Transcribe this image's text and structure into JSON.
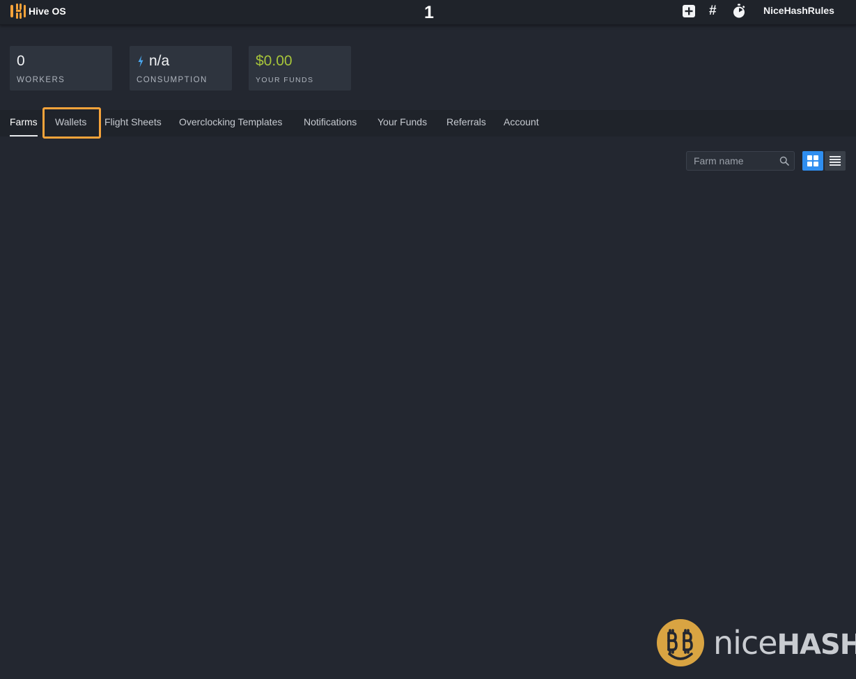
{
  "app": {
    "brand_name": "Hive OS",
    "step_number": "1",
    "username": "NiceHashRules"
  },
  "header_icons": [
    "plus-square-icon",
    "hash-icon",
    "stopwatch-icon"
  ],
  "stats": {
    "workers": {
      "value": "0",
      "label": "WORKERS"
    },
    "consumption": {
      "value": "n/a",
      "label": "CONSUMPTION"
    },
    "funds": {
      "value": "$0.00",
      "label": "YOUR FUNDS",
      "value_color": "#a6c43a"
    }
  },
  "tabs": [
    {
      "label": "Farms",
      "active": true
    },
    {
      "label": "Wallets",
      "active": false,
      "highlighted": true
    },
    {
      "label": "Flight Sheets",
      "active": false
    },
    {
      "label": "Overclocking Templates",
      "active": false
    },
    {
      "label": "Notifications",
      "active": false
    },
    {
      "label": "Your Funds",
      "active": false
    },
    {
      "label": "Referrals",
      "active": false
    },
    {
      "label": "Account",
      "active": false
    }
  ],
  "search": {
    "placeholder": "Farm name",
    "value": ""
  },
  "view_toggle": {
    "selected": "grid",
    "options": [
      "grid",
      "list"
    ]
  },
  "colors": {
    "accent": "#2f8ef0",
    "highlight": "#f6a33a",
    "funds_green": "#a6c43a",
    "brand_orange": "#f6a33a"
  },
  "watermark": {
    "word_light": "nice",
    "word_bold": "HASH"
  }
}
